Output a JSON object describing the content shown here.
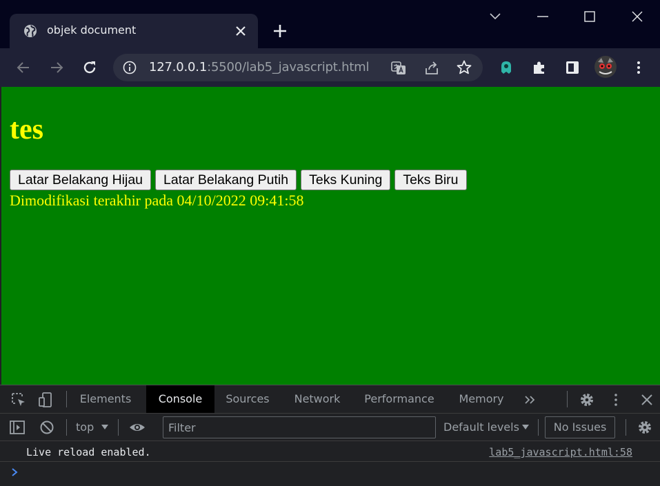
{
  "browser": {
    "tab": {
      "title": "objek document",
      "favicon": "globe-icon"
    },
    "address": {
      "host": "127.0.0.1",
      "rest": ":5500/lab5_javascript.html"
    },
    "colors": {
      "titlebar": "#04051c",
      "toolbar": "#1f2136",
      "omnibox": "#2d3041"
    }
  },
  "page": {
    "heading": "tes",
    "buttons": [
      {
        "label": "Latar Belakang Hijau"
      },
      {
        "label": "Latar Belakang Putih"
      },
      {
        "label": "Teks Kuning"
      },
      {
        "label": "Teks Biru"
      }
    ],
    "modified_text": "Dimodifikasi terakhir pada 04/10/2022 09:41:58",
    "colors": {
      "background": "#008000",
      "text": "#ffff00"
    }
  },
  "devtools": {
    "tabs": [
      {
        "label": "Elements"
      },
      {
        "label": "Console",
        "active": true
      },
      {
        "label": "Sources"
      },
      {
        "label": "Network"
      },
      {
        "label": "Performance"
      },
      {
        "label": "Memory"
      }
    ],
    "context": "top",
    "filter_placeholder": "Filter",
    "levels": "Default levels",
    "issues": "No Issues",
    "messages": [
      {
        "text": "Live reload enabled.",
        "source": "lab5_javascript.html:58"
      }
    ]
  }
}
